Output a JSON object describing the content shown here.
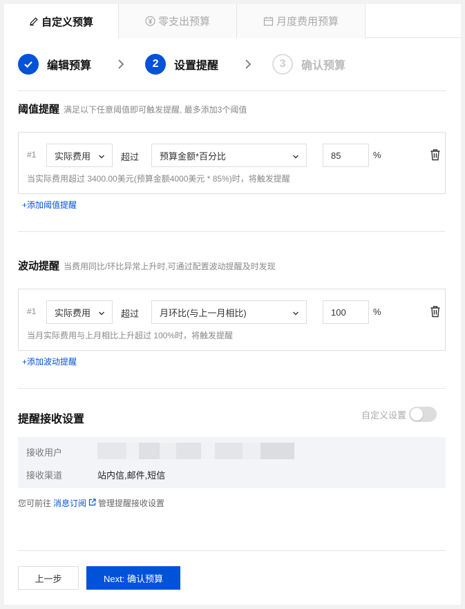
{
  "tabs": [
    {
      "label": "自定义预算",
      "icon": "pencil-icon",
      "active": true
    },
    {
      "label": "零支出预算",
      "icon": "yen-icon",
      "active": false
    },
    {
      "label": "月度费用预算",
      "icon": "calendar-icon",
      "active": false
    }
  ],
  "steps": [
    {
      "label": "编辑预算",
      "marker": "",
      "state": "done"
    },
    {
      "label": "设置提醒",
      "marker": "2",
      "state": "current"
    },
    {
      "label": "确认预算",
      "marker": "3",
      "state": "todo"
    }
  ],
  "threshold": {
    "title": "阈值提醒",
    "desc": "满足以下任意阈值即可触发提醒, 最多添加3个阈值",
    "rule": {
      "index": "#1",
      "metric": "实际费用",
      "operator": "超过",
      "mode": "预算金额*百分比",
      "value": "85",
      "unit": "%",
      "hint": "当实际费用超过 3400.00美元(预算金额4000美元 * 85%)时，将触发提醒"
    },
    "add_label": "+添加阈值提醒"
  },
  "fluctuation": {
    "title": "波动提醒",
    "desc": "当费用同比/环比异常上升时,可通过配置波动提醒及时发现",
    "rule": {
      "index": "#1",
      "metric": "实际费用",
      "operator": "超过",
      "mode": "月环比(与上一月相比)",
      "value": "100",
      "unit": "%",
      "hint": "当月实际费用与上月相比上升超过 100%时，将触发提醒"
    },
    "add_label": "+添加波动提醒"
  },
  "receive": {
    "title": "提醒接收设置",
    "toggle_label": "自定义设置",
    "toggle_on": false,
    "users_label": "接收用户",
    "channels_label": "接收渠道",
    "channels_value": "站内信,邮件,短信"
  },
  "footer": {
    "prefix": "您可前往",
    "link": "消息订阅",
    "suffix": "管理提醒接收设置"
  },
  "buttons": {
    "prev": "上一步",
    "next": "Next: 确认预算"
  },
  "colors": {
    "primary": "#0052d9",
    "muted": "#888888"
  }
}
